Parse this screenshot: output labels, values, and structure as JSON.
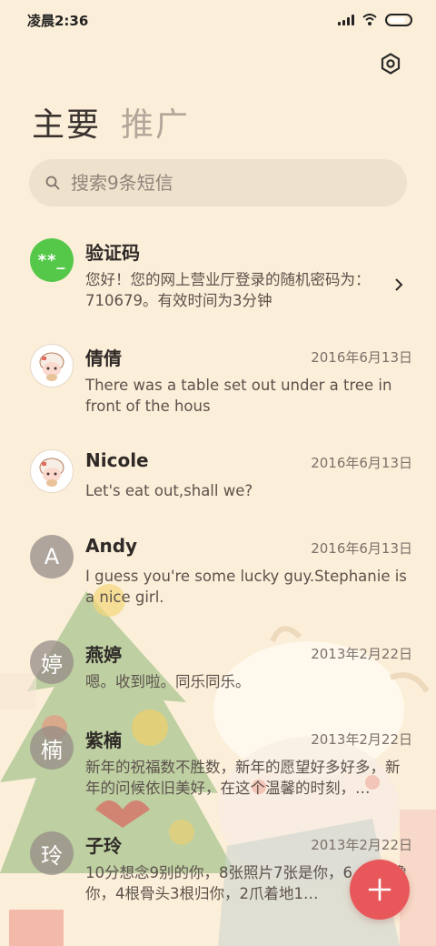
{
  "status_bar": {
    "time": "凌晨2:36"
  },
  "icons": {
    "settings": "settings-icon",
    "search": "search-icon",
    "compose": "plus-icon",
    "chevron": "chevron-right-icon"
  },
  "tabs": [
    {
      "label": "主要",
      "active": true
    },
    {
      "label": "推广",
      "active": false
    }
  ],
  "search": {
    "placeholder": "搜索9条短信"
  },
  "conversations": [
    {
      "name": "验证码",
      "avatar_text": "**_",
      "date": "",
      "message": "您好！您的网上营业厅登录的随机密码为：710679。有效时间为3分钟"
    },
    {
      "name": "倩倩",
      "avatar_text": "",
      "date": "2016年6月13日",
      "message": "There was a table set out under a tree in front of the hous"
    },
    {
      "name": "Nicole",
      "avatar_text": "",
      "date": "2016年6月13日",
      "message": "Let's eat out,shall we?"
    },
    {
      "name": "Andy",
      "avatar_text": "A",
      "date": "2016年6月13日",
      "message": "I guess you're some lucky guy.Stephanie is a nice girl."
    },
    {
      "name": "燕婷",
      "avatar_text": "婷",
      "date": "2013年2月22日",
      "message": "嗯。收到啦。同乐同乐。"
    },
    {
      "name": "紫楠",
      "avatar_text": "楠",
      "date": "2013年2月22日",
      "message": "新年的祝福数不胜数，新年的愿望好多好多，新年的问候依旧美好，在这个温馨的时刻，…"
    },
    {
      "name": "子玲",
      "avatar_text": "玲",
      "date": "2013年2月22日",
      "message": "10分想念9别的你，8张照片7张是你，6…5只像你，4根骨头3根归你，2爪着地1…"
    }
  ],
  "colors": {
    "background": "#fcefd9",
    "accent_fab": "#e8585a",
    "otp_avatar": "#55c84a"
  }
}
